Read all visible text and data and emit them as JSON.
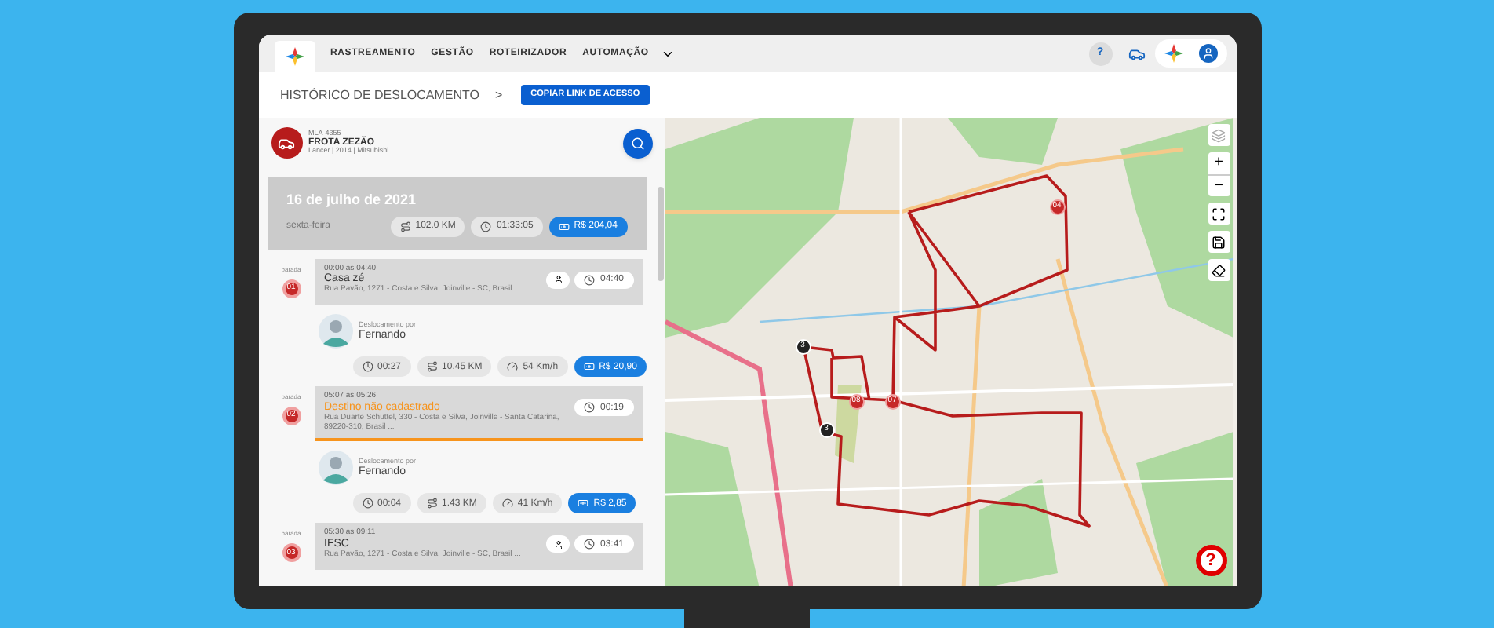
{
  "nav": {
    "tabs": [
      {
        "label": "RASTREAMENTO"
      },
      {
        "label": "GESTÃO"
      },
      {
        "label": "ROTEIRIZADOR"
      },
      {
        "label": "AUTOMAÇÃO"
      }
    ],
    "help": "?"
  },
  "header": {
    "title": "HISTÓRICO DE DESLOCAMENTO",
    "separator": ">",
    "button": "COPIAR LINK DE ACESSO"
  },
  "vehicle": {
    "plate": "MLA-4355",
    "name": "FROTA ZEZÃO",
    "details": "Lancer | 2014 | Mitsubishi"
  },
  "day": {
    "date": "16 de julho de 2021",
    "weekday": "sexta-feira",
    "distance": "102.0 KM",
    "duration": "01:33:05",
    "cost": "R$ 204,04"
  },
  "timeline": [
    {
      "kind": "stop",
      "label": "parada",
      "number": "01",
      "time": "00:00 as 04:40",
      "name": "Casa zé",
      "registered": true,
      "selected": false,
      "address": "Rua Pavão, 1271 - Costa e Silva, Joinville - SC, Brasil ...",
      "duration": "04:40"
    },
    {
      "kind": "trip",
      "caption": "Deslocamento por",
      "driver": "Fernando",
      "duration": "00:27",
      "distance": "10.45 KM",
      "speed": "54 Km/h",
      "cost": "R$ 20,90"
    },
    {
      "kind": "stop",
      "label": "parada",
      "number": "02",
      "time": "05:07 as 05:26",
      "name": "Destino não cadastrado",
      "registered": false,
      "selected": true,
      "address": "Rua Duarte Schuttel, 330 - Costa e Silva, Joinville - Santa Catarina, 89220-310, Brasil ...",
      "duration": "00:19"
    },
    {
      "kind": "trip",
      "caption": "Deslocamento por",
      "driver": "Fernando",
      "duration": "00:04",
      "distance": "1.43 KM",
      "speed": "41 Km/h",
      "cost": "R$ 2,85"
    },
    {
      "kind": "stop",
      "label": "parada",
      "number": "03",
      "time": "05:30 as 09:11",
      "name": "IFSC",
      "registered": true,
      "selected": false,
      "address": "Rua Pavão, 1271 - Costa e Silva, Joinville - SC, Brasil ...",
      "duration": "03:41"
    }
  ],
  "map": {
    "zoom_in": "+",
    "zoom_out": "−",
    "help": "?",
    "markers": [
      {
        "label": "04",
        "kind": "stop"
      },
      {
        "label": "08",
        "kind": "stop"
      },
      {
        "label": "07",
        "kind": "stop"
      },
      {
        "label": "3",
        "kind": "cluster"
      },
      {
        "label": "3",
        "kind": "cluster"
      }
    ]
  }
}
